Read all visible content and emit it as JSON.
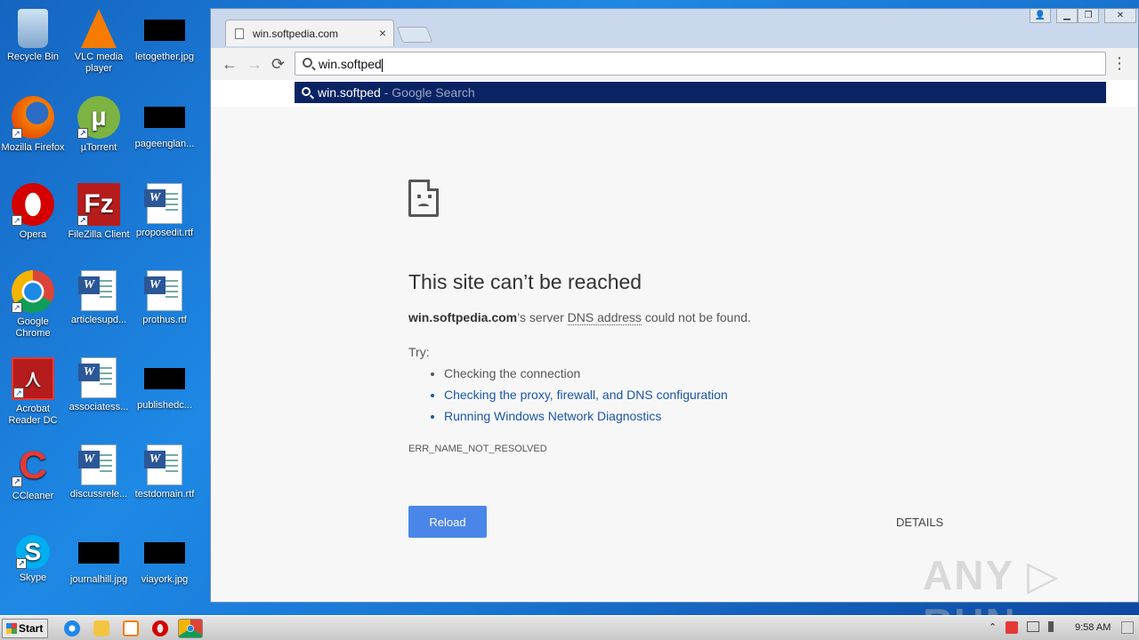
{
  "desktop": {
    "icons": [
      {
        "label": "Recycle Bin"
      },
      {
        "label": "VLC media player"
      },
      {
        "label": "letogether.jpg"
      },
      {
        "label": "Mozilla Firefox"
      },
      {
        "label": "µTorrent"
      },
      {
        "label": "pageenglan..."
      },
      {
        "label": "Opera"
      },
      {
        "label": "FileZilla Client"
      },
      {
        "label": "proposedit.rtf"
      },
      {
        "label": "Google Chrome"
      },
      {
        "label": "articlesupd..."
      },
      {
        "label": "prothus.rtf"
      },
      {
        "label": "Acrobat Reader DC"
      },
      {
        "label": "associatess..."
      },
      {
        "label": "publishedc..."
      },
      {
        "label": "CCleaner"
      },
      {
        "label": "discussrele..."
      },
      {
        "label": "testdomain.rtf"
      },
      {
        "label": "Skype"
      },
      {
        "label": "journalhill.jpg"
      },
      {
        "label": "viayork.jpg"
      }
    ]
  },
  "browser": {
    "tab_title": "win.softpedia.com",
    "tab_close": "×",
    "omnibox_text": "win.softped",
    "suggestion": {
      "query": "win.softped",
      "suffix": " - Google Search"
    },
    "window_controls": {
      "user": "👤",
      "minimize": "▁",
      "restore": "❐",
      "close": "✕"
    },
    "nav": {
      "back": "←",
      "forward": "→",
      "reload": "⟳",
      "menu": "⋮"
    }
  },
  "error_page": {
    "title": "This site can’t be reached",
    "host": "win.softpedia.com",
    "msg_middle": "’s server ",
    "msg_abbr": "DNS address",
    "msg_end": " could not be found.",
    "try_label": "Try:",
    "suggestions": [
      "Checking the connection",
      "Checking the proxy, firewall, and DNS configuration",
      "Running Windows Network Diagnostics"
    ],
    "error_code": "ERR_NAME_NOT_RESOLVED",
    "reload_button": "Reload",
    "details_button": "DETAILS"
  },
  "watermark": "ANY ▷ RUN",
  "taskbar": {
    "start_label": "Start",
    "clock": "9:58 AM",
    "tray_arrow": "⌃"
  },
  "colors": {
    "accent": "#4a86e8",
    "link": "#1a56a8",
    "suggest_bg": "#0a2463"
  }
}
